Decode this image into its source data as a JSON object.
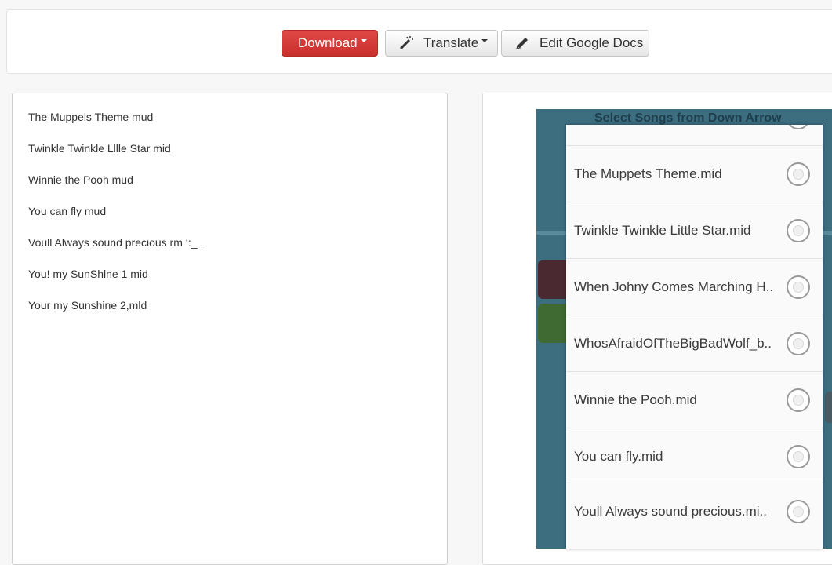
{
  "toolbar": {
    "download_label": "Download",
    "translate_label": "Translate",
    "edit_label": "Edit Google Docs",
    "colors": {
      "download_bg": "#d9534f",
      "default_bg": "#f0f0f0"
    }
  },
  "ocr_text": {
    "lines": [
      "The Muppels Theme mud",
      "Twinkle Twinkle Lllle Star mid",
      "Winnie the Pooh mud",
      "You can fly mud",
      "Voull Always sound precious rm ‘:_ ,",
      "You! my SunShlne 1 mid",
      "Your my Sunshine 2,mld"
    ]
  },
  "screenshot": {
    "background_title": "Select Songs from Down Arrow",
    "songs": [
      "",
      "The Muppets Theme.mid",
      "Twinkle Twinkle Little Star.mid",
      "When Johny Comes Marching H..",
      "WhosAfraidOfTheBigBadWolf_b..",
      "Winnie the Pooh.mid",
      "You can fly.mid",
      "Youll Always sound precious.mi.."
    ]
  }
}
